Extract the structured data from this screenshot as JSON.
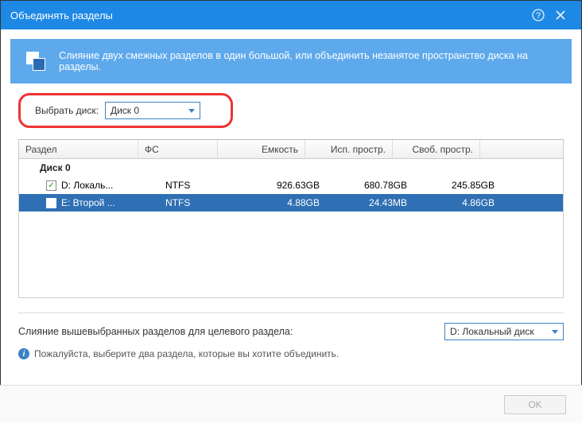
{
  "title": "Объединять разделы",
  "banner": "Слияние двух смежных разделов в один большой, или объединить незанятое пространство диска на разделы.",
  "select_disk_label": "Выбрать диск:",
  "select_disk_value": "Диск 0",
  "headers": {
    "name": "Раздел",
    "fs": "ФС",
    "cap": "Емкость",
    "used": "Исп. простр.",
    "free": "Своб. простр."
  },
  "group": "Диск 0",
  "rows": [
    {
      "label": "D:  Локаль...",
      "fs": "NTFS",
      "cap": "926.63GB",
      "used": "680.78GB",
      "free": "245.85GB"
    },
    {
      "label": "E:  Второй ...",
      "fs": "NTFS",
      "cap": "4.88GB",
      "used": "24.43MB",
      "free": "4.86GB"
    }
  ],
  "merge_label": "Слияние вышевыбранных разделов для целевого раздела:",
  "target_value": "D:  Локальный диск",
  "hint": "Пожалуйста, выберите два раздела, которые вы хотите объединить.",
  "ok": "OK"
}
